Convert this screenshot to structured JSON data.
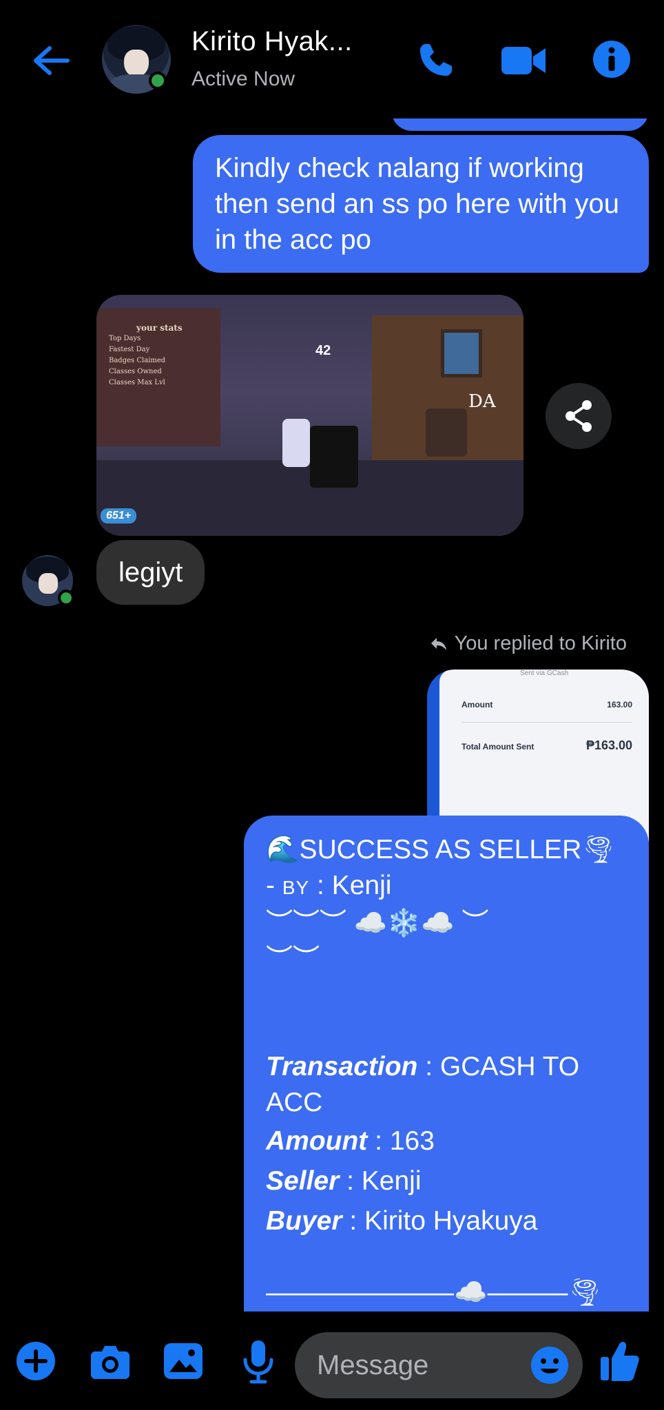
{
  "header": {
    "name": "Kirito Hyak...",
    "status": "Active Now"
  },
  "messages": {
    "sent1": "Kindly check nalang if working then send an ss po here with you in the acc po",
    "photo": {
      "board_title": "your stats",
      "board_lines": [
        "Top Days",
        "Fastest Day",
        "Badges Claimed",
        "Classes Owned",
        "Classes Max Lvl"
      ],
      "counter": "42",
      "gem_count": "651+",
      "sign": "DA"
    },
    "received1": "legiyt",
    "replied_label": "You replied to Kirito",
    "receipt": {
      "sent_via": "Sent via GCash",
      "amount_label": "Amount",
      "amount_value": "163.00",
      "total_label": "Total Amount Sent",
      "total_value": "₱163.00"
    },
    "success": {
      "line1": "🌊SUCCESS AS SELLER🌪",
      "line2_prefix": "- ",
      "line2_by": "BY",
      "line2_rest": " : Kenji",
      "line3": "︶︶︶ ☁️❄️☁️ ︶",
      "line4": "︶︶",
      "transaction_label": "Transaction",
      "transaction_value": " : GCASH TO ACC",
      "amount_label": "Amount",
      "amount_value": " : 163",
      "seller_label": "Seller",
      "seller_value": " : Kenji",
      "buyer_label": "Buyer",
      "buyer_value": " : Kirito Hyakuya",
      "divider": "―――――――☁️―――🌪",
      "divider2": "―――☁️"
    }
  },
  "composer": {
    "placeholder": "Message"
  },
  "colors": {
    "accent": "#1877f2",
    "sent_bubble": "#3b6cf2",
    "received_bubble": "#303030",
    "online": "#31a24c"
  }
}
